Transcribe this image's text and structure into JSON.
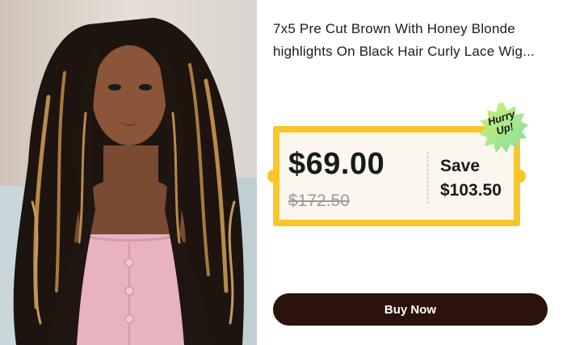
{
  "product": {
    "title_line1": "7x5 Pre Cut Brown With Honey Blonde",
    "title_line2": "highlights On Black Hair Curly Lace Wig...",
    "image_alt": "Model wearing curly black wig with honey blonde highlights"
  },
  "pricing": {
    "sale_price": "$69.00",
    "original_price": "$172.50",
    "save_label": "Save",
    "save_amount": "$103.50"
  },
  "badge": {
    "line1": "Hurry",
    "line2": "Up!"
  },
  "actions": {
    "buy_label": "Buy Now"
  },
  "colors": {
    "coupon_border": "#f9c52a",
    "coupon_fill": "#fbf7ef",
    "button_bg": "#2a130a",
    "badge_fill": "#b8ee6a"
  }
}
